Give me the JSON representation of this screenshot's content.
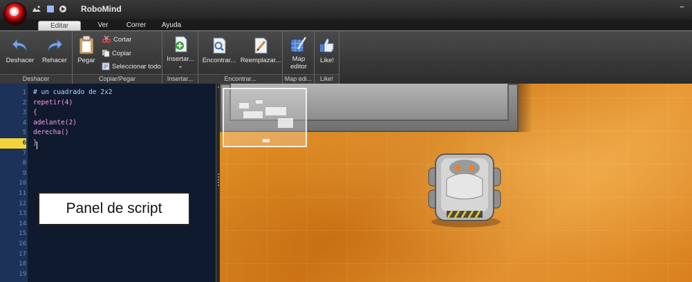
{
  "window": {
    "title": "RoboMind",
    "minimize_glyph": "–"
  },
  "quick_access": [
    "save-icon",
    "stop-icon",
    "run-icon"
  ],
  "tabs": [
    {
      "label": "Editar",
      "active": true
    },
    {
      "label": "Ver"
    },
    {
      "label": "Correr"
    },
    {
      "label": "Ayuda"
    }
  ],
  "ribbon": {
    "groups": {
      "deshacer": "Deshacer",
      "copiar_pegar": "Copiar/Pegar",
      "insertar": "Insertar...",
      "encontrar": "Encontrar...",
      "map_editor": "Map edi...",
      "like": "Like!"
    },
    "buttons": {
      "deshacer": "Deshacer",
      "rehacer": "Rehacer",
      "pegar": "Pegar",
      "cortar": "Cortar",
      "copiar": "Copiar",
      "seleccionar_todo": "Seleccionar todo",
      "insertar": "Insertar...",
      "insertar_chevron": "⌄",
      "encontrar": "Encontrar...",
      "reemplazar": "Reemplazar...",
      "map_editor_line1": "Map",
      "map_editor_line2": "editor",
      "like": "Like!"
    }
  },
  "script": {
    "line_numbers": [
      "1",
      "2",
      "3",
      "4",
      "5",
      "6",
      "7",
      "8",
      "9",
      "10",
      "11",
      "12",
      "13",
      "14",
      "15",
      "16",
      "17",
      "18",
      "19"
    ],
    "active_line": 6,
    "lines": [
      "# un cuadrado de 2x2",
      "repetir(4)",
      "{",
      "adelante(2)",
      "derecha()",
      "}"
    ]
  },
  "callout": {
    "text": "Panel de script"
  },
  "colors": {
    "accent_active_line": "#f2d33b",
    "map_sand": "#e08a25",
    "editor_bg": "#0f1a2e"
  }
}
